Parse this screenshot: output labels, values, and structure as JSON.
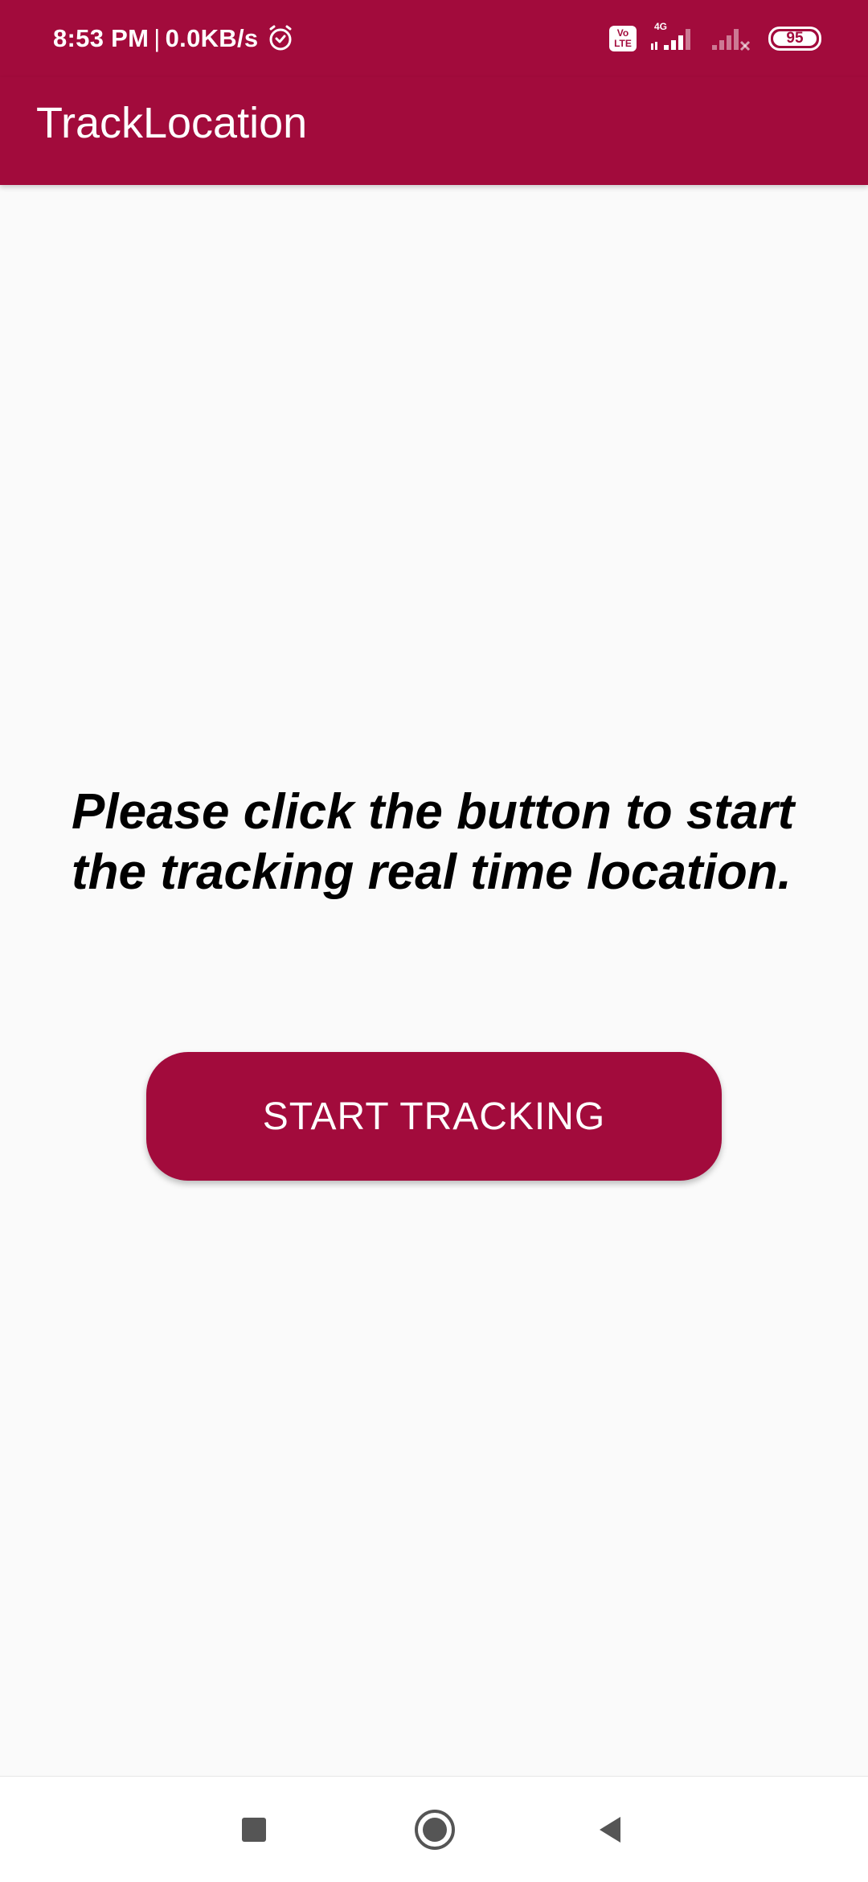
{
  "status_bar": {
    "time": "8:53 PM",
    "separator": "|",
    "net_speed": "0.0KB/s",
    "volte_top": "Vo",
    "volte_bottom": "LTE",
    "network_type": "4G",
    "battery_level": "95",
    "icons": [
      "alarm-icon",
      "volte-icon",
      "signal-4g-icon",
      "signal-no-service-icon",
      "battery-icon"
    ]
  },
  "app_bar": {
    "title": "TrackLocation"
  },
  "main": {
    "message": "Please click the button to start the tracking real time location.",
    "start_button_label": "START TRACKING"
  },
  "nav_bar": {
    "icons": [
      "recents-square-icon",
      "home-circle-icon",
      "back-triangle-icon"
    ]
  },
  "colors": {
    "brand": "#a20b3c",
    "background": "#fafafa",
    "text": "#000000",
    "nav_icon": "#555555"
  }
}
